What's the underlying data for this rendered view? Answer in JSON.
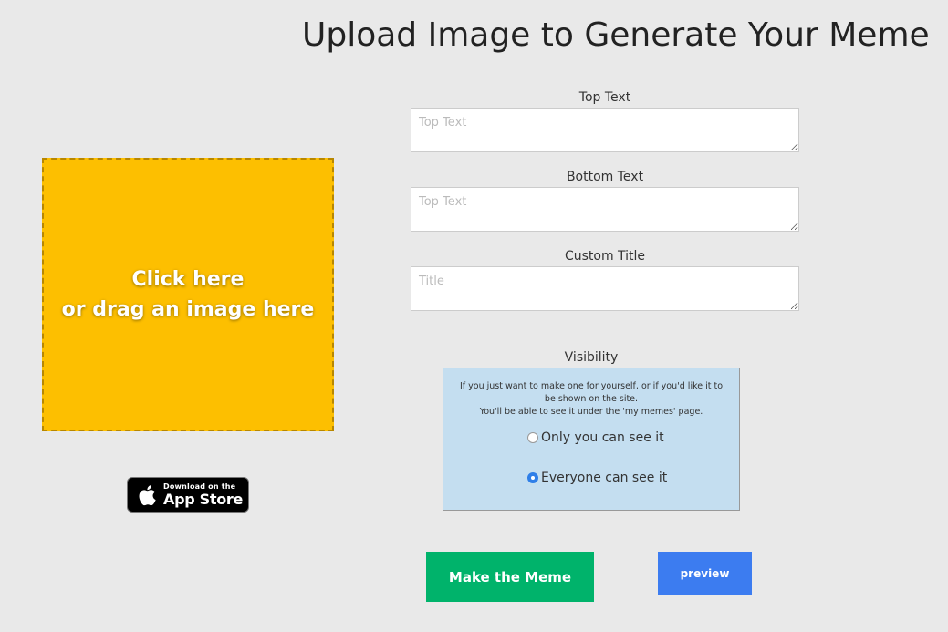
{
  "page": {
    "title": "Upload Image to Generate Your Meme"
  },
  "upload": {
    "line1": "Click here",
    "line2": "or drag an image here",
    "color": "#fdbf00"
  },
  "app_store_badge": {
    "small_text": "Download on the",
    "large_text": "App Store",
    "icon": "apple-icon"
  },
  "form": {
    "top_text": {
      "label": "Top Text",
      "placeholder": "Top Text",
      "value": ""
    },
    "bottom_text": {
      "label": "Bottom Text",
      "placeholder": "Top Text",
      "value": ""
    },
    "custom_title": {
      "label": "Custom Title",
      "placeholder": "Title",
      "value": ""
    }
  },
  "visibility": {
    "label": "Visibility",
    "desc_line1": "If you just want to make one for yourself, or if you'd like it to be shown on the site.",
    "desc_line2": "You'll be able to see it under the 'my memes' page.",
    "options": [
      {
        "label": "Only you can see it",
        "checked": false
      },
      {
        "label": "Everyone can see it",
        "checked": true
      }
    ],
    "color": "#c4def0"
  },
  "actions": {
    "make_label": "Make the Meme",
    "make_color": "#00b36b",
    "preview_label": "preview",
    "preview_color": "#3c7cf0"
  }
}
